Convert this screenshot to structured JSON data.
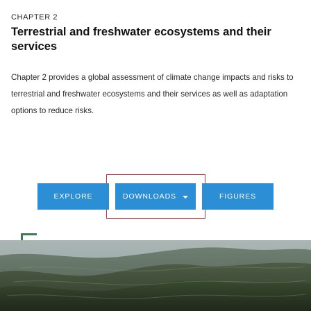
{
  "chapter": {
    "eyebrow": "CHAPTER 2",
    "title": "Terrestrial and freshwater ecosystems and their services",
    "description": "Chapter 2 provides a global assessment of climate change impacts and risks to terrestrial and freshwater ecosystems and their services as well as adaptation options to reduce risks."
  },
  "actions": {
    "explore_label": "EXPLORE",
    "downloads_label": "DOWNLOADS",
    "figures_label": "FIGURES"
  },
  "hero": {
    "subject": "aerial view of forested ridges"
  },
  "colors": {
    "button": "#2c8fd6",
    "focus_ring": "#c4363b",
    "accent": "#3f7a52"
  }
}
